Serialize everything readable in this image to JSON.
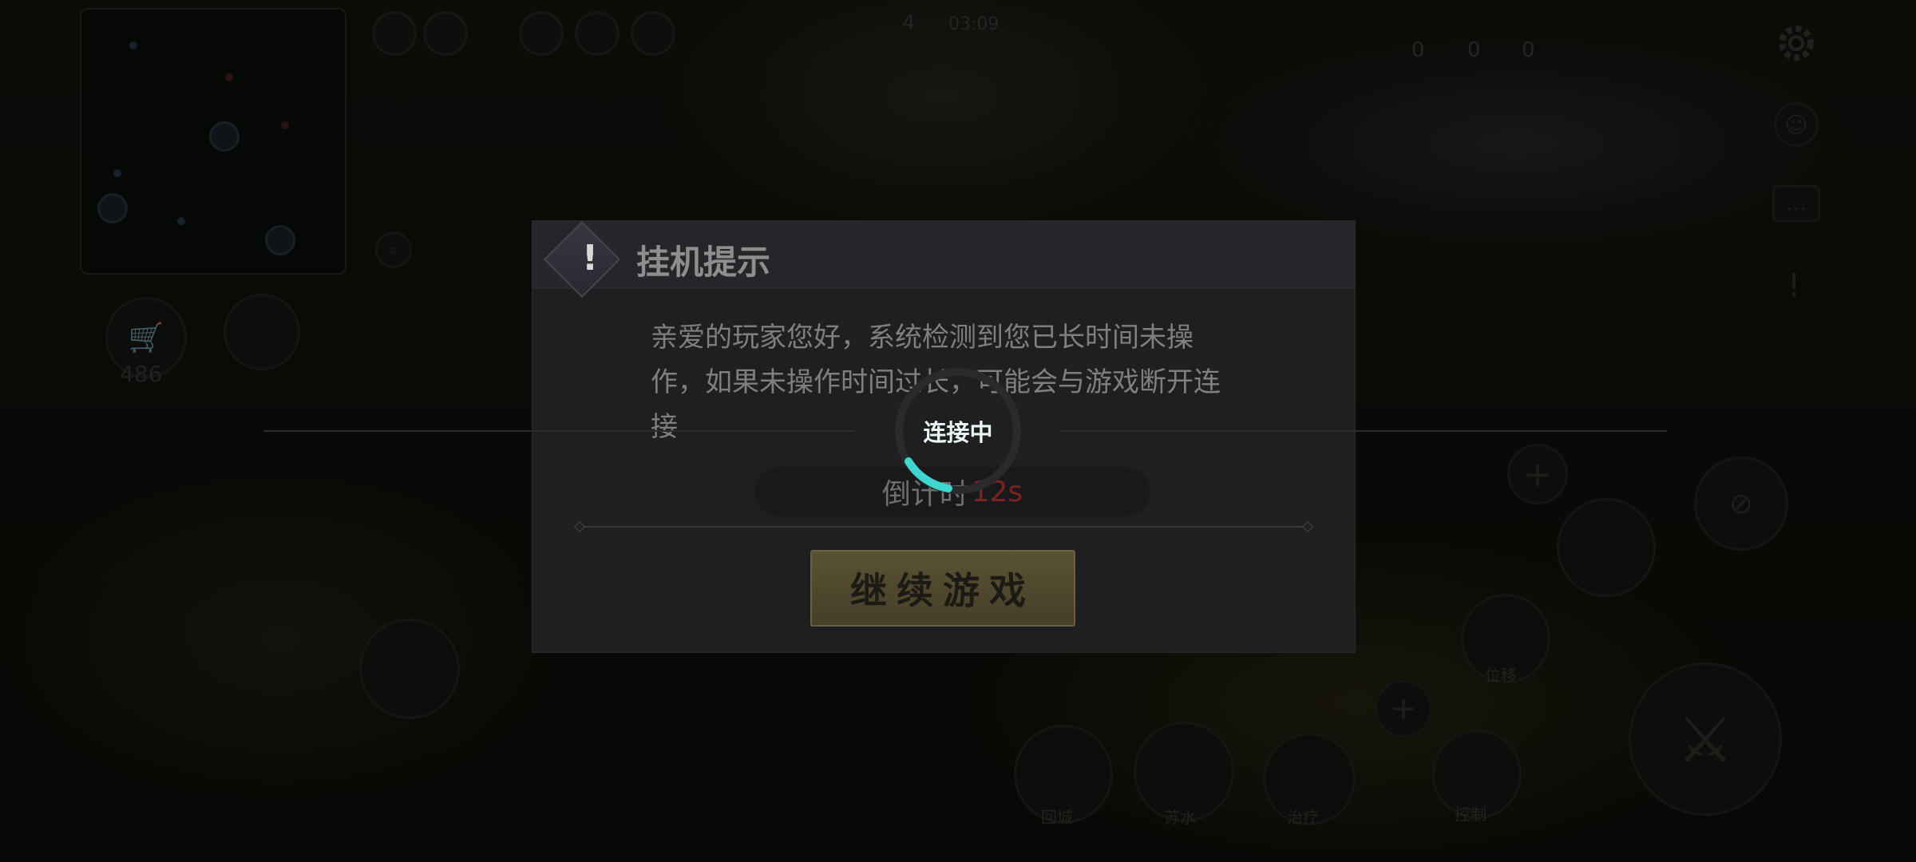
{
  "hud": {
    "gold": "486",
    "timer": "03:09",
    "kda": [
      "0",
      "0",
      "0"
    ],
    "level": "4",
    "skills": {
      "recall": "回城",
      "heal": "治疗",
      "dash": "位移",
      "control": "控制",
      "spell": "苏水",
      "basic": "平A"
    }
  },
  "dialog": {
    "title": "挂机提示",
    "message": "亲爱的玩家您好，系统检测到您已长时间未操作，如果未操作时间过长，可能会与游戏断开连接",
    "countdown_label": "倒计时",
    "countdown_value": "12s",
    "continue_button": "继续游戏"
  },
  "loader": {
    "text": "连接中",
    "color": "#3fd6d0"
  },
  "colors": {
    "countdown_value": "#c0392b",
    "button_gold": "#c8ad6a"
  },
  "icons": {
    "warning": "warning-icon",
    "settings": "gear-icon",
    "shop": "cart-icon",
    "chat": "chat-icon",
    "alert": "exclamation-icon"
  }
}
